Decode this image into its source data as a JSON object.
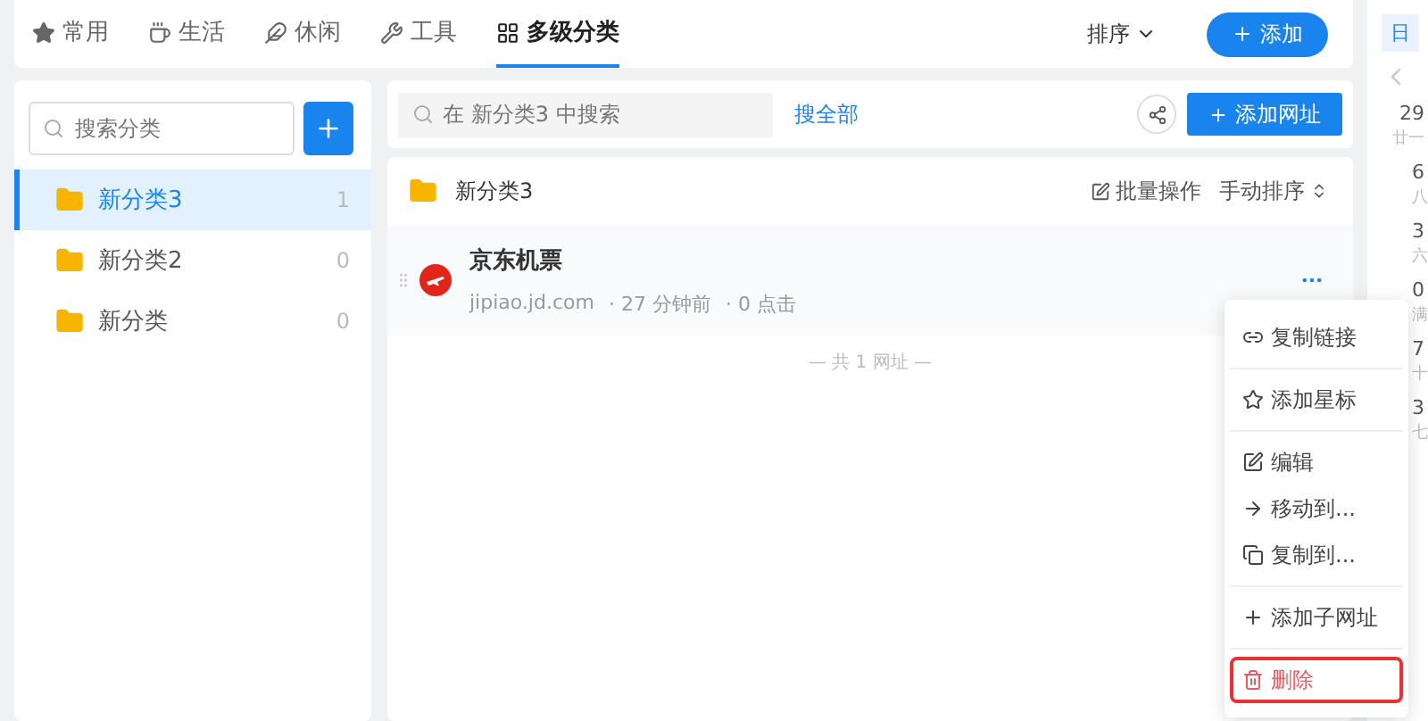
{
  "tabs": [
    {
      "label": "常用",
      "selected": false
    },
    {
      "label": "生活",
      "selected": false
    },
    {
      "label": "休闲",
      "selected": false
    },
    {
      "label": "工具",
      "selected": false
    },
    {
      "label": "多级分类",
      "selected": true
    }
  ],
  "sort_button": "排序",
  "add_button": "添加",
  "sidebar": {
    "search": {
      "placeholder": "搜索分类"
    },
    "items": [
      {
        "name": "新分类3",
        "count": "1",
        "selected": true
      },
      {
        "name": "新分类2",
        "count": "0",
        "selected": false
      },
      {
        "name": "新分类",
        "count": "0",
        "selected": false
      }
    ]
  },
  "toolbar": {
    "search": {
      "placeholder": "在 新分类3 中搜索"
    },
    "search_all": "搜全部",
    "add_url": "添加网址"
  },
  "folder": {
    "name": "新分类3",
    "batch": "批量操作",
    "sort": "手动排序"
  },
  "bookmarks": [
    {
      "title": "京东机票",
      "url": "jipiao.jd.com",
      "time": "· 27 分钟前",
      "clicks": "· 0 点击"
    }
  ],
  "footer": "—  共 1 网址  —",
  "menu": [
    [
      {
        "kind": "link",
        "label": "复制链接",
        "danger": false,
        "highlighted": false
      }
    ],
    [
      {
        "kind": "star",
        "label": "添加星标",
        "danger": false,
        "highlighted": false
      }
    ],
    [
      {
        "kind": "edit",
        "label": "编辑",
        "danger": false,
        "highlighted": false
      },
      {
        "kind": "move",
        "label": "移动到...",
        "danger": false,
        "highlighted": false
      },
      {
        "kind": "copy",
        "label": "复制到...",
        "danger": false,
        "highlighted": false
      }
    ],
    [
      {
        "kind": "add",
        "label": "添加子网址",
        "danger": false,
        "highlighted": false
      }
    ],
    [
      {
        "kind": "delete",
        "label": "删除",
        "danger": true,
        "highlighted": true
      }
    ]
  ],
  "calendar": {
    "tab": "日",
    "days": [
      {
        "date": "29",
        "lunar": "廿一"
      },
      {
        "date": "6",
        "lunar": "八"
      },
      {
        "date": "3",
        "lunar": "六"
      },
      {
        "date": "0",
        "lunar": "满"
      },
      {
        "date": "7",
        "lunar": "十"
      },
      {
        "date": "3",
        "lunar": "七"
      }
    ]
  }
}
